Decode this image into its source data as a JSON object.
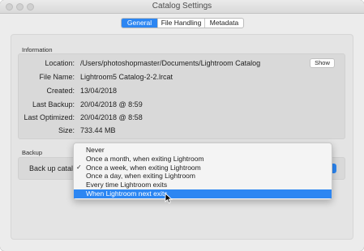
{
  "window": {
    "title": "Catalog Settings"
  },
  "tabs": [
    {
      "label": "General",
      "active": true
    },
    {
      "label": "File Handling",
      "active": false
    },
    {
      "label": "Metadata",
      "active": false
    }
  ],
  "information": {
    "heading": "Information",
    "show_label": "Show",
    "rows": [
      {
        "label": "Location:",
        "value": "/Users/photoshopmaster/Documents/Lightroom Catalog"
      },
      {
        "label": "File Name:",
        "value": "Lightroom5 Catalog-2-2.lrcat"
      },
      {
        "label": "Created:",
        "value": "13/04/2018"
      },
      {
        "label": "Last Backup:",
        "value": "20/04/2018 @ 8:59"
      },
      {
        "label": "Last Optimized:",
        "value": "20/04/2018 @ 8:58"
      },
      {
        "label": "Size:",
        "value": "733.44 MB"
      }
    ]
  },
  "backup": {
    "heading": "Backup",
    "label": "Back up catalog"
  },
  "menu": {
    "items": [
      {
        "label": "Never",
        "checked": false,
        "selected": false
      },
      {
        "label": "Once a month, when exiting Lightroom",
        "checked": false,
        "selected": false
      },
      {
        "label": "Once a week, when exiting Lightroom",
        "checked": true,
        "selected": false
      },
      {
        "label": "Once a day, when exiting Lightroom",
        "checked": false,
        "selected": false
      },
      {
        "label": "Every time Lightroom exits",
        "checked": false,
        "selected": false
      },
      {
        "label": "When Lightroom next exits",
        "checked": false,
        "selected": true
      }
    ],
    "check_glyph": "✓"
  },
  "colors": {
    "accent": "#2c86f2",
    "window_bg": "#ececec",
    "group_bg": "#d9d9d9"
  }
}
